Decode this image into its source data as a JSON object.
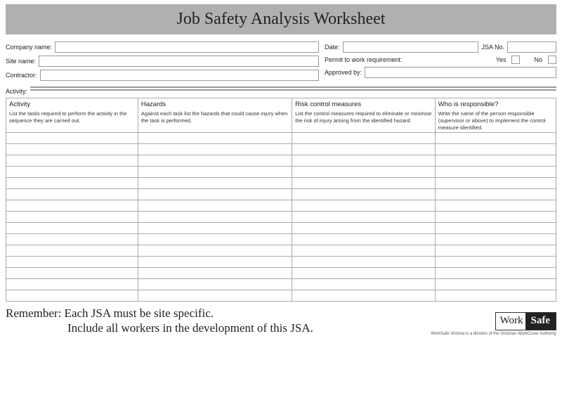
{
  "title": "Job Safety Analysis Worksheet",
  "fields": {
    "company_name": "Company name:",
    "site_name": "Site name:",
    "contractor": "Contractor:",
    "activity": "Activity:",
    "date": "Date:",
    "jsa_no": "JSA No.",
    "permit": "Permit to work requirement:",
    "yes": "Yes",
    "no": "No",
    "approved_by": "Approved by:"
  },
  "columns": {
    "activity": {
      "title": "Activity",
      "desc": "List the tasks required to perform the activity in the sequence they are carried out."
    },
    "hazards": {
      "title": "Hazards",
      "desc": "Against each task list the hazards that could cause injury when the task is performed."
    },
    "risk": {
      "title": "Risk control measures",
      "desc": "List the control measures required to eliminate or minimise the risk of injury arising from the identified hazard."
    },
    "resp": {
      "title": "Who is responsible?",
      "desc": "Write the name of the person responsible (supervisor or above)  to implement the control measure identified."
    }
  },
  "footer": {
    "line1": "Remember: Each JSA must be site specific.",
    "line2": "Include all workers in the development of this JSA."
  },
  "logo": {
    "word1": "Work",
    "word2": "Safe",
    "sub": "WorkSafe Victoria is a division of the Victorian WorkCover Authority"
  }
}
